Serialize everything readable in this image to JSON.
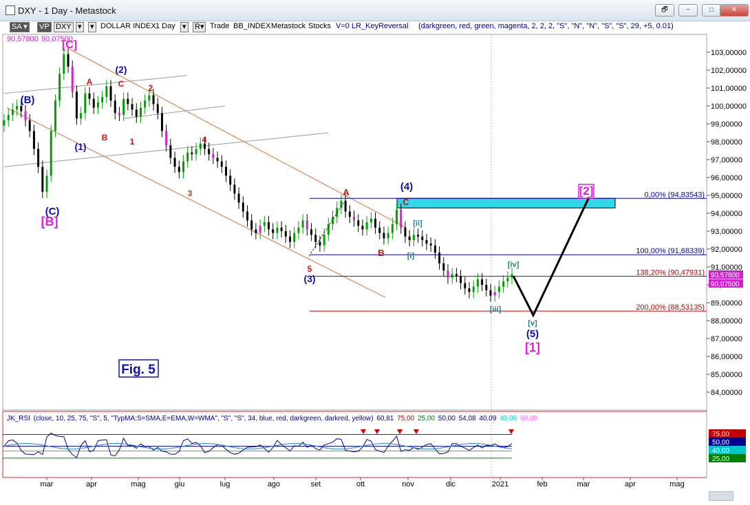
{
  "window": {
    "title": "DXY - 1 Day - Metastock",
    "buttons": [
      "🗗",
      "−",
      "□",
      "✕"
    ]
  },
  "toolbar": {
    "sa": "SA ▾",
    "vp": "VP",
    "symbol": "DXY",
    "instrument": "DOLLAR INDEX",
    "period": "1 Day",
    "r": "R▾",
    "trade": "Trade",
    "source": "BB_INDEX",
    "provider": "Metastock",
    "stocks": "Stocks",
    "indicator": "V=0  LR_KeyReversal",
    "params": "(darkgreen, red, green, magenta, 2, 2, 2, \"S\", \"N\", \"N\", \"S\", \"S\", 29, +5, 0.01)"
  },
  "price_labels": {
    "high": "90,57800",
    "low": "90,07500"
  },
  "chart_data": {
    "type": "candlestick",
    "title": "",
    "xlabel": "",
    "ylabel": "",
    "x_ticks": [
      "mar",
      "apr",
      "mag",
      "giu",
      "lug",
      "ago",
      "set",
      "ott",
      "nov",
      "dic",
      "2021",
      "feb",
      "mar",
      "apr",
      "mag"
    ],
    "y_ticks": [
      "103,00000",
      "102,00000",
      "101,00000",
      "100,00000",
      "99,00000",
      "98,00000",
      "97,00000",
      "96,00000",
      "95,00000",
      "94,00000",
      "93,00000",
      "92,00000",
      "91,00000",
      "90,00000",
      "89,00000",
      "88,00000",
      "87,00000",
      "86,00000",
      "85,00000",
      "84,00000"
    ],
    "ylim": [
      83.0,
      104.0
    ],
    "close_series": [
      99.2,
      99.5,
      99.8,
      100.0,
      99.7,
      99.2,
      98.6,
      97.6,
      96.6,
      95.2,
      96.1,
      98.6,
      100.3,
      101.8,
      102.9,
      102.2,
      100.8,
      99.3,
      99.6,
      100.7,
      100.4,
      99.9,
      100.2,
      100.5,
      101.1,
      100.3,
      99.6,
      99.5,
      100.4,
      100.1,
      99.8,
      99.4,
      99.9,
      100.3,
      100.6,
      100.1,
      99.6,
      98.6,
      97.8,
      97.1,
      96.6,
      96.3,
      96.9,
      97.4,
      97.3,
      97.6,
      97.9,
      97.6,
      97.3,
      97.1,
      96.9,
      96.6,
      96.1,
      95.6,
      95.1,
      94.6,
      94.1,
      93.6,
      93.1,
      92.9,
      93.3,
      93.5,
      93.1,
      92.9,
      93.2,
      93.0,
      92.7,
      92.4,
      92.9,
      93.2,
      93.6,
      93.1,
      92.8,
      92.4,
      92.2,
      92.8,
      93.4,
      93.8,
      94.3,
      94.7,
      94.1,
      93.8,
      93.6,
      93.3,
      93.1,
      93.5,
      93.7,
      93.2,
      92.9,
      92.6,
      92.9,
      93.4,
      94.2,
      93.2,
      92.7,
      92.5,
      92.8,
      92.7,
      92.5,
      92.3,
      92.2,
      91.8,
      91.2,
      90.8,
      90.4,
      90.6,
      90.5,
      90.1,
      89.8,
      89.6,
      89.9,
      90.3,
      90.0,
      89.7,
      89.4,
      89.6,
      89.9,
      90.2,
      90.4,
      90.6
    ],
    "fib_levels": [
      {
        "label": "0,00% (94,83543)",
        "value": 94.83543
      },
      {
        "label": "100,00% (91,68339)",
        "value": 91.68339
      },
      {
        "label": "138,20% (90,47931)",
        "value": 90.47931
      },
      {
        "label": "200,00% (88,53135)",
        "value": 88.53135
      }
    ],
    "wave_labels": [
      {
        "text": "[C]",
        "color": "#e020e0"
      },
      {
        "text": "(B)",
        "color": "#1010b0"
      },
      {
        "text": "(C)",
        "color": "#1010b0"
      },
      {
        "text": "[B]",
        "color": "#e020e0"
      },
      {
        "text": "(1)",
        "color": "#1010b0"
      },
      {
        "text": "(2)",
        "color": "#1010b0"
      },
      {
        "text": "A",
        "color": "#d01010"
      },
      {
        "text": "B",
        "color": "#d01010"
      },
      {
        "text": "C",
        "color": "#d01010"
      },
      {
        "text": "1",
        "color": "#d01010"
      },
      {
        "text": "2",
        "color": "#d01010"
      },
      {
        "text": "3",
        "color": "#c04010"
      },
      {
        "text": "4",
        "color": "#d01010"
      },
      {
        "text": "5",
        "color": "#d01010"
      },
      {
        "text": "(3)",
        "color": "#1010b0"
      },
      {
        "text": "A",
        "color": "#d01010"
      },
      {
        "text": "B",
        "color": "#d01010"
      },
      {
        "text": "C",
        "color": "#d01010"
      },
      {
        "text": "(4)",
        "color": "#1010b0"
      },
      {
        "text": "[i]",
        "color": "#208080"
      },
      {
        "text": "[ii]",
        "color": "#208080"
      },
      {
        "text": "[iii]",
        "color": "#208080"
      },
      {
        "text": "[iv]",
        "color": "#208080"
      },
      {
        "text": "[v]",
        "color": "#208080"
      },
      {
        "text": "(5)",
        "color": "#1010b0"
      },
      {
        "text": "[1]",
        "color": "#e020e0"
      },
      {
        "text": "[2]",
        "color": "#e020e0"
      }
    ],
    "fig_label": "Fig. 5"
  },
  "rsi": {
    "name": "JK_RSI",
    "params": "(close,  10,  25,  75,  \"S\",  5,  \"TypMA:S=SMA,E=EMA,W=WMA\",  \"S\",  \"S\",  34,  blue,  red,  darkgreen,  darkred,  yellow)",
    "values": [
      {
        "text": "60,81",
        "color": "#00008b"
      },
      {
        "text": "75,00",
        "color": "#c00000"
      },
      {
        "text": "25,00",
        "color": "#008000"
      },
      {
        "text": "50,00",
        "color": "#00008b"
      },
      {
        "text": "54,08",
        "color": "#00008b"
      },
      {
        "text": "40,09",
        "color": "#00008b"
      },
      {
        "text": "40,00",
        "color": "#00c8c8"
      },
      {
        "text": "60,00",
        "color": "#ff60ff"
      }
    ],
    "axis_labels": [
      {
        "text": "75,00",
        "color": "#c00000"
      },
      {
        "text": "50,00",
        "color": "#00008b"
      },
      {
        "text": "40,00",
        "color": "#00c8c8"
      },
      {
        "text": "25,00",
        "color": "#008000"
      }
    ]
  },
  "colors": {
    "up": "#00a000",
    "down": "#000000",
    "magenta": "#d020d0",
    "box": "#30d8e8",
    "channel": "#e07030"
  }
}
